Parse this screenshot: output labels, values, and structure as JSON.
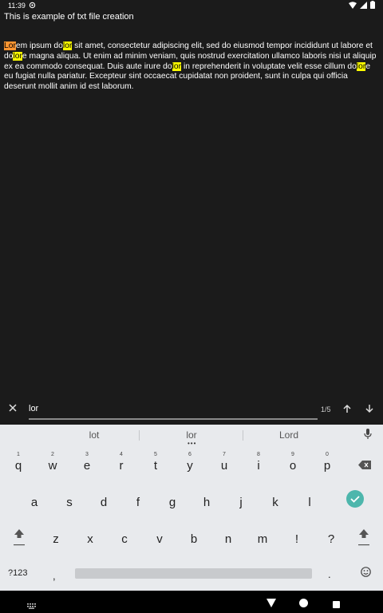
{
  "status": {
    "time": "11:39"
  },
  "doc": {
    "title": "This is example of txt file creation",
    "segments": [
      {
        "t": "Lor",
        "h": "active"
      },
      {
        "t": "em ipsum do",
        "h": ""
      },
      {
        "t": "lor",
        "h": "match"
      },
      {
        "t": " sit amet, consectetur adipiscing elit, sed do eiusmod tempor incididunt ut labore et do",
        "h": ""
      },
      {
        "t": "lor",
        "h": "match"
      },
      {
        "t": "e magna aliqua. Ut enim ad minim veniam, quis nostrud exercitation ullamco laboris nisi ut aliquip ex ea commodo consequat. Duis aute irure do",
        "h": ""
      },
      {
        "t": "lor",
        "h": "match"
      },
      {
        "t": " in reprehenderit in voluptate velit esse cillum do",
        "h": ""
      },
      {
        "t": "lor",
        "h": "match"
      },
      {
        "t": "e eu fugiat nulla pariatur. Excepteur sint occaecat cupidatat non proident, sunt in culpa qui officia deserunt mollit anim id est laborum.",
        "h": ""
      }
    ]
  },
  "find": {
    "query": "lor",
    "count": "1/5"
  },
  "keyboard": {
    "suggestions": [
      "lot",
      "lor",
      "Lord"
    ],
    "row1": [
      {
        "k": "q",
        "hint": "1"
      },
      {
        "k": "w",
        "hint": "2"
      },
      {
        "k": "e",
        "hint": "3"
      },
      {
        "k": "r",
        "hint": "4"
      },
      {
        "k": "t",
        "hint": "5"
      },
      {
        "k": "y",
        "hint": "6"
      },
      {
        "k": "u",
        "hint": "7"
      },
      {
        "k": "i",
        "hint": "8"
      },
      {
        "k": "o",
        "hint": "9"
      },
      {
        "k": "p",
        "hint": "0"
      }
    ],
    "row2": [
      "a",
      "s",
      "d",
      "f",
      "g",
      "h",
      "j",
      "k",
      "l"
    ],
    "row3": [
      "z",
      "x",
      "c",
      "v",
      "b",
      "n",
      "m",
      "!",
      "?"
    ],
    "symbols_label": "?123",
    "comma": ",",
    "period": "."
  },
  "colors": {
    "highlight": "#ffff00",
    "highlight_active": "#ff9632",
    "accent": "#4db6ac"
  }
}
